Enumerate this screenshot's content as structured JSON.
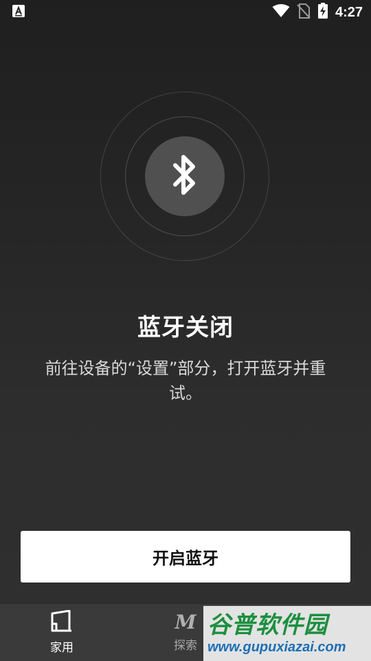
{
  "status_bar": {
    "time": "4:27",
    "icons": [
      "app-notification-icon",
      "wifi-icon",
      "no-sim-icon",
      "battery-charging-icon"
    ]
  },
  "bluetooth": {
    "icon": "bluetooth-icon",
    "title": "蓝牙关闭",
    "description": "前往设备的“设置”部分，打开蓝牙并重试。",
    "enable_button": "开启蓝牙"
  },
  "bottom_nav": {
    "items": [
      {
        "label": "家用",
        "icon": "home-icon"
      },
      {
        "label": "探索",
        "icon": "explore-m-icon",
        "glyph": "M"
      }
    ]
  },
  "watermark": {
    "main": "谷普软件园",
    "sub": "www.gupuxiazai.com"
  },
  "colors": {
    "background": "#262626",
    "button_bg": "#ffffff",
    "nav_bg": "#3a3a3a",
    "watermark_green": "#1c8f3f",
    "watermark_blue": "#1c6fb5"
  }
}
